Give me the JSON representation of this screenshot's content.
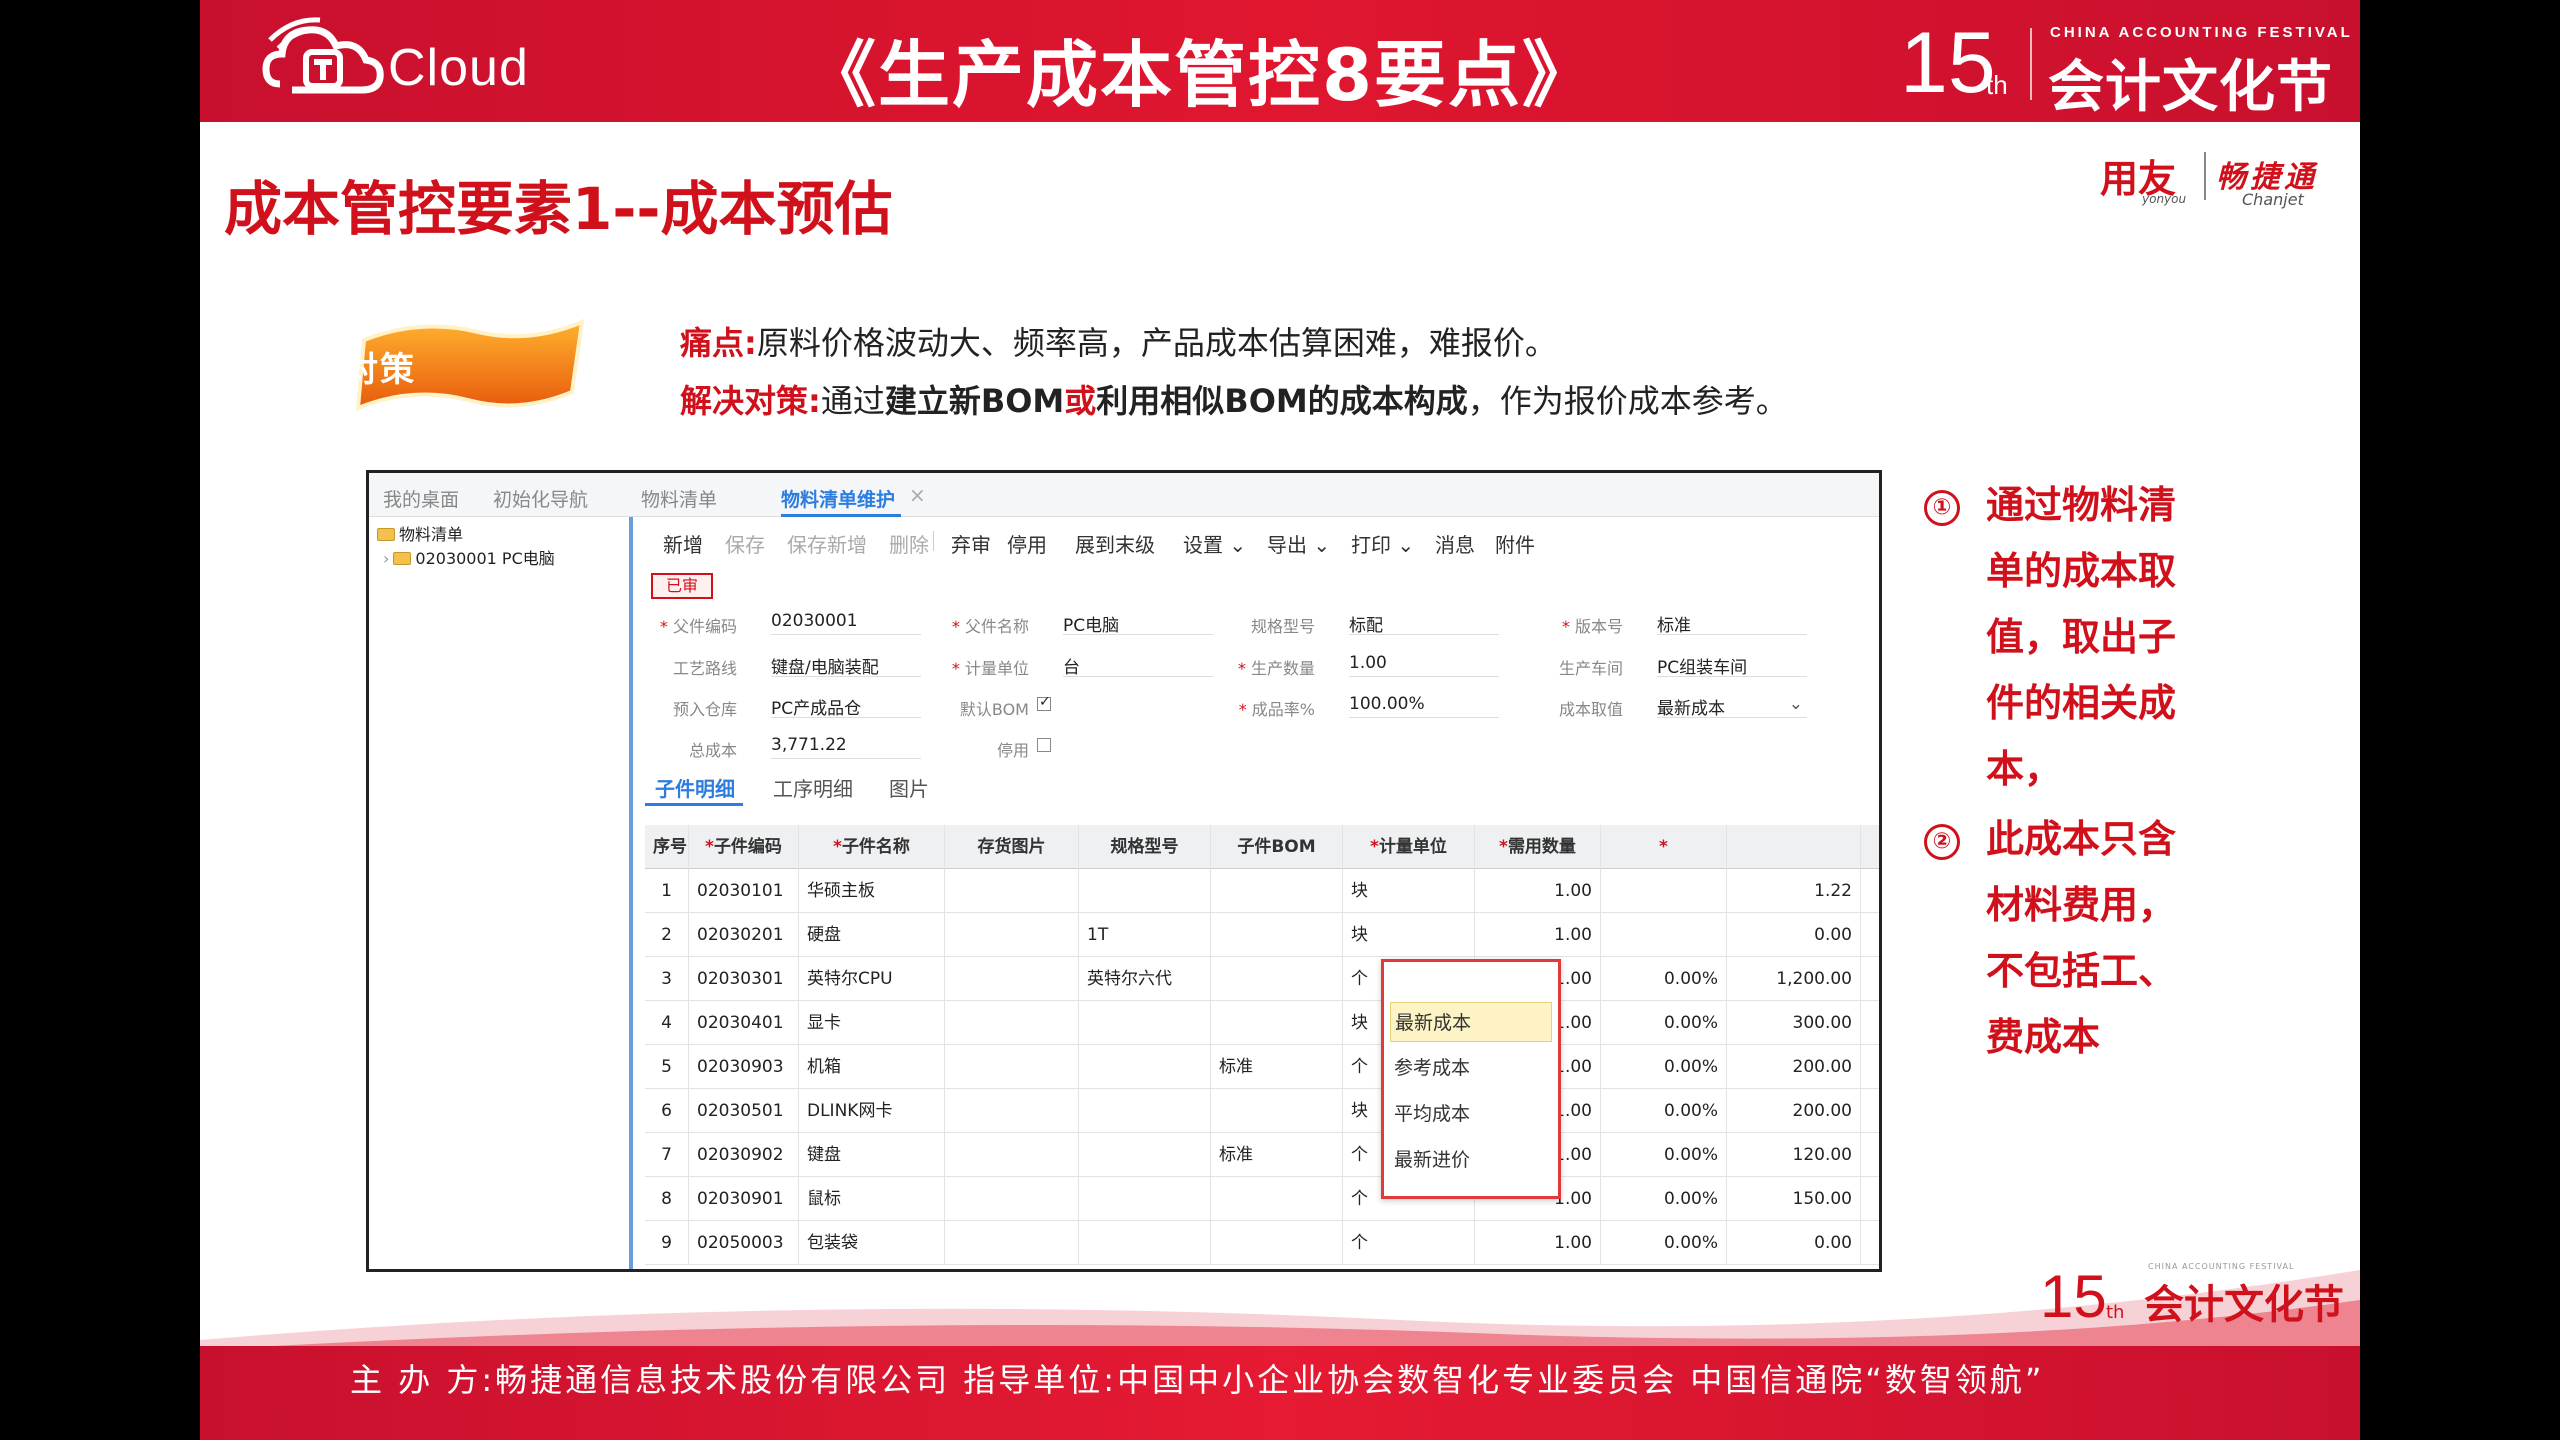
{
  "banner": {
    "logo_text": "Cloud",
    "title": "《生产成本管控8要点》",
    "festival_number": "15",
    "festival_suffix": "th",
    "festival_en": "CHINA ACCOUNTING FESTIVAL",
    "festival_cn": "会计文化节"
  },
  "slide_title": "成本管控要素1--成本预估",
  "brand": {
    "yonyou": "用友",
    "yonyou_en": "yonyou",
    "chanjet": "畅捷通",
    "chanjet_en": "Chanjet"
  },
  "badge_label": "解决对策",
  "pain": {
    "label": "痛点:",
    "text": "原料价格波动大、频率高，产品成本估算困难，难报价。"
  },
  "solution": {
    "label": "解决对策:",
    "prefix": "通过",
    "bold1": "建立新BOM",
    "or": "或",
    "bold2": "利用相似BOM的成本构成",
    "suffix": "，作为报价成本参考。"
  },
  "app": {
    "tabs": [
      "我的桌面",
      "初始化导航",
      "物料清单",
      "物料清单维护"
    ],
    "tree": {
      "root": "物料清单",
      "child": "02030001 PC电脑"
    },
    "toolbar": [
      "新增",
      "保存",
      "保存新增",
      "删除",
      "弃审",
      "停用",
      "展到末级",
      "设置",
      "导出",
      "打印",
      "消息",
      "附件"
    ],
    "status": "已审",
    "fields": {
      "parent_code_label": "父件编码",
      "parent_code": "02030001",
      "parent_name_label": "父件名称",
      "parent_name": "PC电脑",
      "spec_label": "规格型号",
      "spec": "标配",
      "version_label": "版本号",
      "version": "标准",
      "route_label": "工艺路线",
      "route": "键盘/电脑装配",
      "unit_label": "计量单位",
      "unit": "台",
      "qty_label": "生产数量",
      "qty": "1.00",
      "workshop_label": "生产车间",
      "workshop": "PC组装车间",
      "warehouse_label": "预入仓库",
      "warehouse": "PC产成品仓",
      "default_bom_label": "默认BOM",
      "yield_label": "成品率%",
      "yield": "100.00%",
      "cost_source_label": "成本取值",
      "cost_source": "最新成本",
      "total_label": "总成本",
      "total": "3,771.22",
      "disabled_label": "停用"
    },
    "detail_tabs": [
      "子件明细",
      "工序明细",
      "图片"
    ],
    "columns": [
      "序号",
      "子件编码",
      "子件名称",
      "存货图片",
      "规格型号",
      "子件BOM",
      "计量单位",
      "需用数量",
      "",
      ""
    ],
    "rows": [
      [
        "1",
        "02030101",
        "华硕主板",
        "",
        "",
        "",
        "块",
        "1.00",
        "",
        "1.22"
      ],
      [
        "2",
        "02030201",
        "硬盘",
        "",
        "1T",
        "",
        "块",
        "1.00",
        "",
        "0.00"
      ],
      [
        "3",
        "02030301",
        "英特尔CPU",
        "",
        "英特尔六代",
        "",
        "个",
        "1.00",
        "0.00%",
        "1,200.00"
      ],
      [
        "4",
        "02030401",
        "显卡",
        "",
        "",
        "",
        "块",
        "1.00",
        "0.00%",
        "300.00"
      ],
      [
        "5",
        "02030903",
        "机箱",
        "",
        "",
        "标准",
        "个",
        "1.00",
        "0.00%",
        "200.00"
      ],
      [
        "6",
        "02030501",
        "DLINK网卡",
        "",
        "",
        "",
        "块",
        "1.00",
        "0.00%",
        "200.00"
      ],
      [
        "7",
        "02030902",
        "键盘",
        "",
        "",
        "标准",
        "个",
        "1.00",
        "0.00%",
        "120.00"
      ],
      [
        "8",
        "02030901",
        "鼠标",
        "",
        "",
        "",
        "个",
        "1.00",
        "0.00%",
        "150.00"
      ],
      [
        "9",
        "02050003",
        "包装袋",
        "",
        "",
        "",
        "个",
        "1.00",
        "0.00%",
        "0.00"
      ]
    ],
    "dropdown": [
      "最新成本",
      "参考成本",
      "平均成本",
      "最新进价"
    ]
  },
  "annotations": {
    "n1": "①",
    "a1": [
      "通过物料清",
      "单的成本取",
      "值，取出子",
      "件的相关成",
      "本，"
    ],
    "n2": "②",
    "a2": [
      "此成本只含",
      "材料费用，",
      "不包括工、",
      "费成本"
    ]
  },
  "footer": {
    "text": "主 办 方:畅捷通信息技术股份有限公司      指导单位:中国中小企业协会数智化专业委员会    中国信通院“数智领航”",
    "festival_number": "15",
    "festival_suffix": "th",
    "festival_cn": "会计文化节",
    "festival_en": "CHINA ACCOUNTING FESTIVAL"
  },
  "colors": {
    "brand_red": "#d0111b",
    "accent_blue": "#2d7de0"
  }
}
